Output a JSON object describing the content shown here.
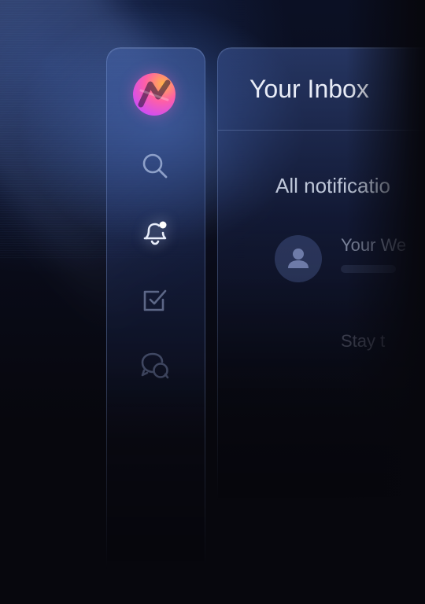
{
  "header": {
    "title": "Your Inbox"
  },
  "sidebar": {
    "items": [
      {
        "icon": "logo-icon",
        "active": false
      },
      {
        "icon": "search-icon",
        "active": false
      },
      {
        "icon": "bell-icon",
        "active": true,
        "has_badge": true
      },
      {
        "icon": "checkbox-icon",
        "active": false
      },
      {
        "icon": "chat-icon",
        "active": false
      }
    ]
  },
  "main": {
    "section_label": "All notificatio",
    "notifications": [
      {
        "title": "Your We"
      },
      {
        "title": "Stay t"
      }
    ]
  },
  "colors": {
    "logo_gradient_start": "#ffb34a",
    "logo_gradient_mid": "#ff5fa6",
    "logo_gradient_end": "#c84bff",
    "icon_color": "#cfd8ee"
  }
}
